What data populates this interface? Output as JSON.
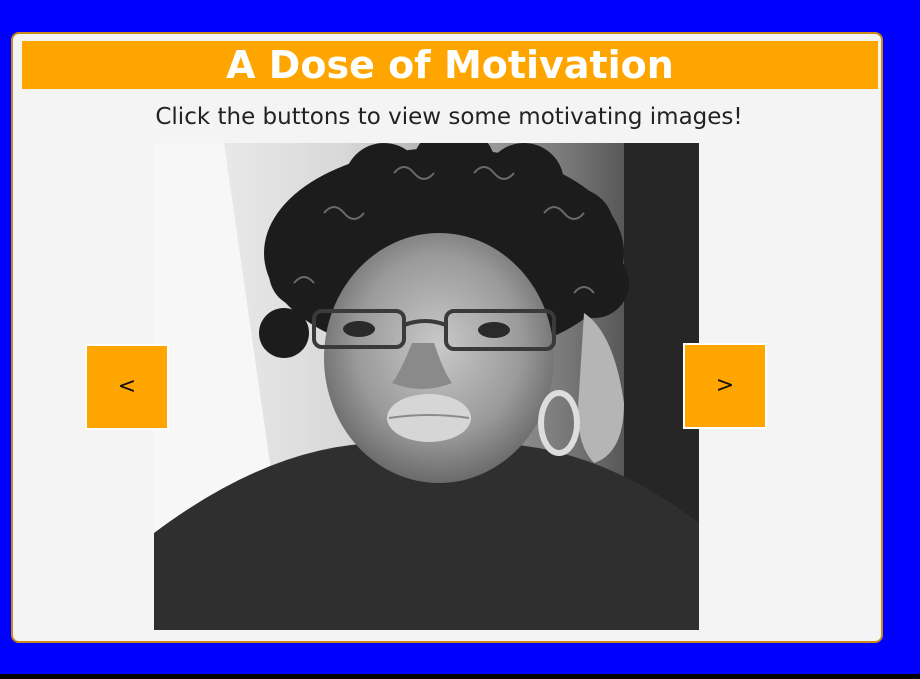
{
  "header": {
    "title": "A Dose of Motivation"
  },
  "intro": {
    "text": "Click the buttons to view some motivating images!"
  },
  "carousel": {
    "prev_label": "<",
    "next_label": ">"
  },
  "colors": {
    "page_background": "#0000ff",
    "accent": "#ffa500",
    "card_background": "#f4f4f4"
  }
}
